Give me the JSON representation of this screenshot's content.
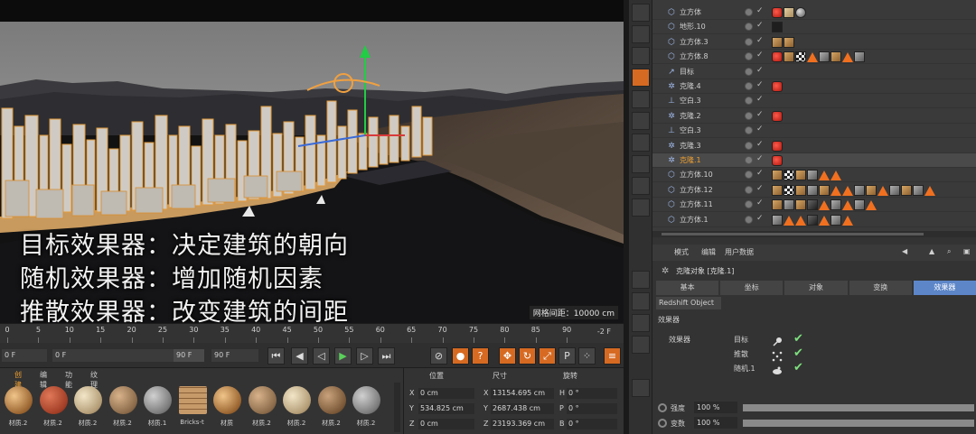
{
  "captions": [
    "目标效果器：决定建筑的朝向",
    "随机效果器：增加随机因素",
    "推散效果器：改变建筑的间距"
  ],
  "viewport": {
    "view_range": "网格间距：10000 cm"
  },
  "timeline": {
    "ticks": [
      "0",
      "5",
      "10",
      "15",
      "20",
      "25",
      "30",
      "35",
      "40",
      "45",
      "50",
      "55",
      "60",
      "65",
      "70",
      "75",
      "80",
      "85",
      "90"
    ],
    "end_frame": "-2 F",
    "current_frame": "0 F",
    "start_field": "0 F",
    "range_field": "90 F",
    "end_field": "90 F"
  },
  "materials": {
    "menu": [
      "创建",
      "编辑",
      "功能",
      "纹理"
    ],
    "items": [
      {
        "label": "材质.2",
        "color": "wood"
      },
      {
        "label": "材质.2",
        "color": "brick"
      },
      {
        "label": "材质.2",
        "color": "sand"
      },
      {
        "label": "材质.2",
        "color": "wood2"
      },
      {
        "label": "材质.1",
        "color": "grey"
      },
      {
        "label": "Bricks-t",
        "color": "bricks"
      },
      {
        "label": "材质",
        "color": "wood"
      },
      {
        "label": "材质.2",
        "color": "wood2"
      },
      {
        "label": "材质.2",
        "color": "sand"
      },
      {
        "label": "材质.2",
        "color": "wood3"
      },
      {
        "label": "材质.2",
        "color": "grey"
      }
    ]
  },
  "coordinates": {
    "headers": [
      "位置",
      "尺寸",
      "旋转"
    ],
    "rows": [
      {
        "axis": "X",
        "pos": "0 cm",
        "size_axis": "X",
        "size": "13154.695 cm",
        "rot_axis": "H",
        "rot": "0 °"
      },
      {
        "axis": "Y",
        "pos": "534.825 cm",
        "size_axis": "Y",
        "size": "2687.438 cm",
        "rot_axis": "P",
        "rot": "0 °"
      },
      {
        "axis": "Z",
        "pos": "0 cm",
        "size_axis": "Z",
        "size": "23193.369 cm",
        "rot_axis": "B",
        "rot": "0 °"
      }
    ]
  },
  "object_manager": {
    "rows": [
      {
        "name": "立方体",
        "icon": "cube",
        "tags": [
          "red",
          "sand",
          "ball"
        ]
      },
      {
        "name": "地形.10",
        "icon": "cube",
        "tags": [
          "black"
        ]
      },
      {
        "name": "立方体.3",
        "icon": "cube",
        "tags": [
          "wood",
          "wood"
        ]
      },
      {
        "name": "立方体.8",
        "icon": "cube",
        "tags": [
          "red",
          "wood",
          "check",
          "orange",
          "grey",
          "wood",
          "orange",
          "grey"
        ]
      },
      {
        "name": "目标",
        "icon": "target",
        "tags": []
      },
      {
        "name": "克隆.4",
        "icon": "gear",
        "tags": [
          "red"
        ]
      },
      {
        "name": "空白.3",
        "icon": "null",
        "tags": []
      },
      {
        "name": "克隆.2",
        "icon": "gear",
        "tags": [
          "red"
        ]
      },
      {
        "name": "空白.3",
        "icon": "null",
        "tags": []
      },
      {
        "name": "克隆.3",
        "icon": "gear",
        "tags": [
          "red"
        ]
      },
      {
        "name": "克隆.1",
        "icon": "gear",
        "tags": [
          "red"
        ],
        "selected": true
      },
      {
        "name": "立方体.10",
        "icon": "cube",
        "tags": [
          "wood",
          "check",
          "wood",
          "grey",
          "orange",
          "orange"
        ]
      },
      {
        "name": "立方体.12",
        "icon": "cube",
        "tags": [
          "wood",
          "check",
          "wood",
          "grey",
          "wood",
          "orange",
          "orange",
          "grey",
          "wood",
          "orange",
          "grey",
          "wood",
          "grey",
          "orange"
        ]
      },
      {
        "name": "立方体.11",
        "icon": "cube",
        "tags": [
          "wood",
          "grey",
          "wood",
          "dark",
          "orange",
          "grey",
          "orange",
          "grey",
          "orange"
        ]
      },
      {
        "name": "立方体.1",
        "icon": "cube",
        "tags": [
          "grey",
          "orange",
          "orange",
          "dark",
          "orange",
          "grey",
          "orange"
        ]
      }
    ]
  },
  "attributes": {
    "menu": [
      "模式",
      "编辑",
      "用户数据"
    ],
    "title": "克隆对象 [克隆.1]",
    "tabs": [
      "基本",
      "坐标",
      "对象",
      "变换",
      "效果器"
    ],
    "active_tab": "效果器",
    "redshift": "Redshift Object",
    "section": "效果器",
    "effectors_label": "效果器",
    "effectors": [
      {
        "name": "目标"
      },
      {
        "name": "推散"
      },
      {
        "name": "随机.1"
      }
    ],
    "fields": [
      {
        "label": "强度",
        "value": "100 %"
      },
      {
        "label": "变数",
        "value": "100 %"
      }
    ]
  }
}
